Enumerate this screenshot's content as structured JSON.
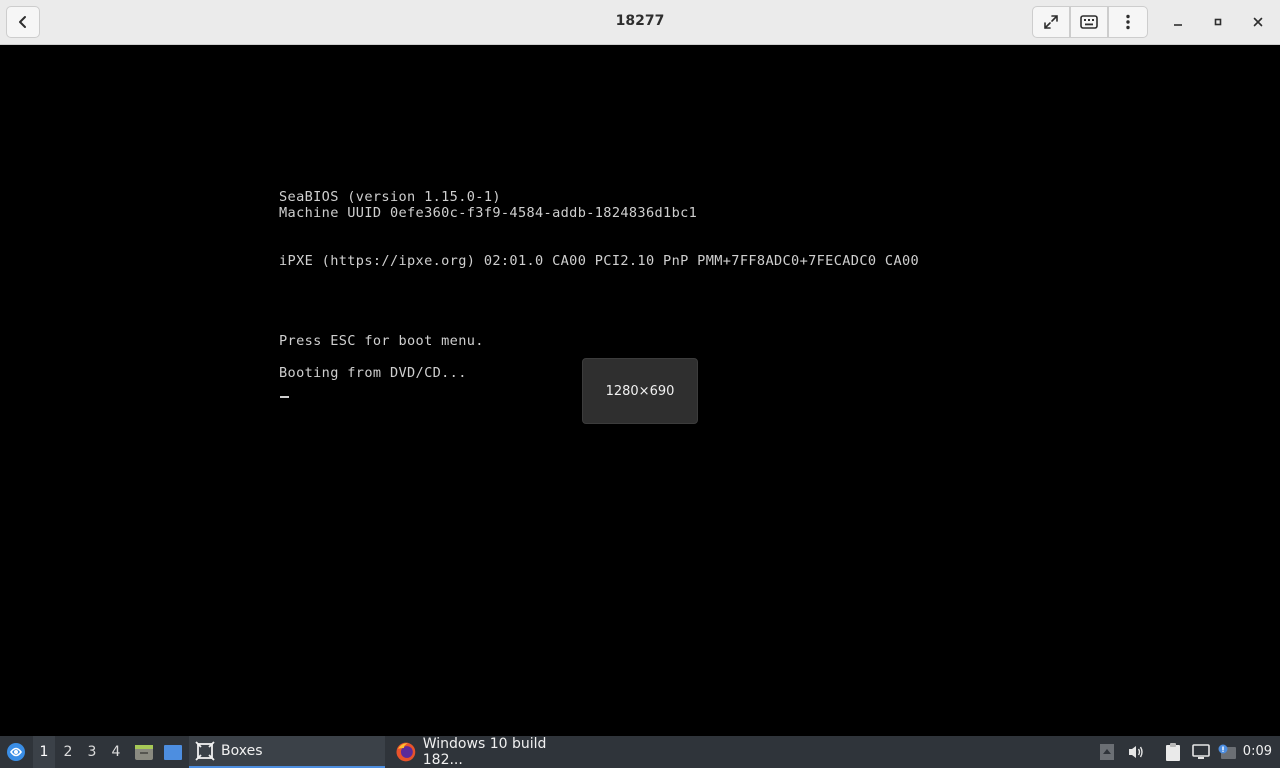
{
  "window": {
    "title": "18277",
    "back_icon": "arrow-left-icon",
    "fullscreen_icon": "fullscreen-icon",
    "keyboard_icon": "keyboard-icon",
    "menu_icon": "vertical-dots-icon"
  },
  "console": {
    "lines": [
      "SeaBIOS (version 1.15.0-1)",
      "Machine UUID 0efe360c-f3f9-4584-addb-1824836d1bc1",
      "iPXE (https://ipxe.org) 02:01.0 CA00 PCI2.10 PnP PMM+7FF8ADC0+7FECADC0 CA00",
      "Press ESC for boot menu.",
      "Booting from DVD/CD..."
    ],
    "resolution_overlay": "1280×690"
  },
  "taskbar": {
    "workspaces": [
      "1",
      "2",
      "3",
      "4"
    ],
    "active_workspace": "1",
    "tasks": [
      {
        "label": "Boxes",
        "icon": "boxes-app-icon",
        "active": true
      },
      {
        "label": "Windows 10 build 182...",
        "icon": "firefox-icon",
        "active": false
      }
    ],
    "clock": "0:09",
    "accent": "#4d8ee0"
  }
}
